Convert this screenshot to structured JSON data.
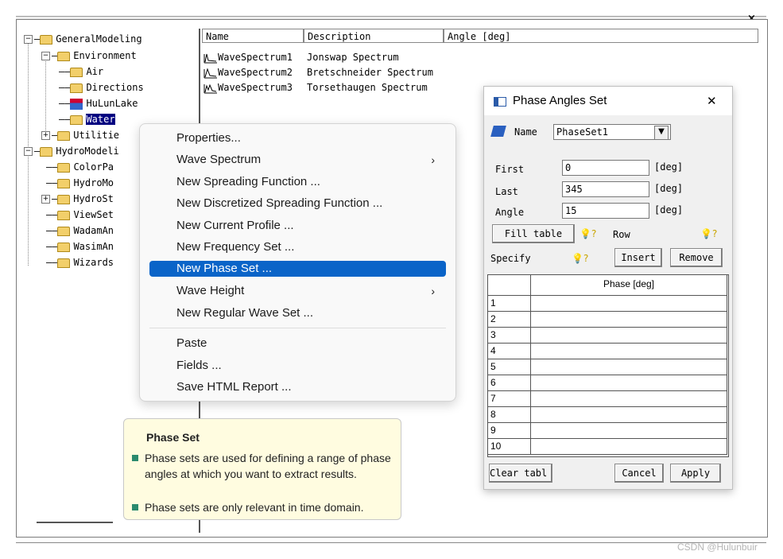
{
  "tree": {
    "items": [
      {
        "label": "GeneralModeling",
        "expander": "−"
      },
      {
        "label": "Environment",
        "expander": "−"
      },
      {
        "label": "Air"
      },
      {
        "label": "Directions"
      },
      {
        "label": "HuLunLake"
      },
      {
        "label": "Water"
      },
      {
        "label": "Utilitie",
        "expander": "+"
      },
      {
        "label": "HydroModeli",
        "expander": "−"
      },
      {
        "label": "ColorPa"
      },
      {
        "label": "HydroMo"
      },
      {
        "label": "HydroSt",
        "expander": "+"
      },
      {
        "label": "ViewSet"
      },
      {
        "label": "WadamAn"
      },
      {
        "label": "WasimAn"
      },
      {
        "label": "Wizards"
      }
    ]
  },
  "list": {
    "headers": [
      "Name",
      "Description",
      "Angle [deg]"
    ],
    "rows": [
      {
        "name": "WaveSpectrum1",
        "description": "Jonswap Spectrum"
      },
      {
        "name": "WaveSpectrum2",
        "description": "Bretschneider Spectrum"
      },
      {
        "name": "WaveSpectrum3",
        "description": "Torsethaugen Spectrum"
      }
    ]
  },
  "context_menu": {
    "items": [
      "Properties...",
      "Wave Spectrum",
      "New Spreading Function ...",
      "New Discretized Spreading Function ...",
      "New Current Profile ...",
      "New Frequency Set ...",
      "New Phase Set ...",
      "Wave Height",
      "New Regular Wave Set ...",
      "Paste",
      "Fields ...",
      "Save HTML Report ..."
    ],
    "submenu_arrow": "›"
  },
  "tooltip": {
    "title": "Phase Set",
    "bullets": [
      "Phase sets are used for defining a range of phase angles at which you want to extract results.",
      "Phase sets are only relevant in time domain."
    ]
  },
  "dialog": {
    "title": "Phase Angles Set",
    "close": "✕",
    "name_label": "Name",
    "name_value": "PhaseSet1",
    "first_label": "First",
    "first_value": "0",
    "last_label": "Last",
    "last_value": "345",
    "angle_label": "Angle",
    "angle_value": "15",
    "unit": "[deg]",
    "fill_table": "Fill table",
    "row_label": "Row",
    "specify_label": "Specify",
    "insert": "Insert",
    "remove": "Remove",
    "column_header": "Phase [deg]",
    "rows": [
      "1",
      "2",
      "3",
      "4",
      "5",
      "6",
      "7",
      "8",
      "9",
      "10"
    ],
    "clear_table": "Clear tabl",
    "cancel": "Cancel",
    "apply": "Apply",
    "bulb_glyph": "💡?"
  },
  "window": {
    "close": "×"
  },
  "watermark": "CSDN @Hulunbuir",
  "colors": {
    "selection": "#0a64c8",
    "tree_selection": "#000080",
    "tooltip_bg": "#fffce0"
  }
}
